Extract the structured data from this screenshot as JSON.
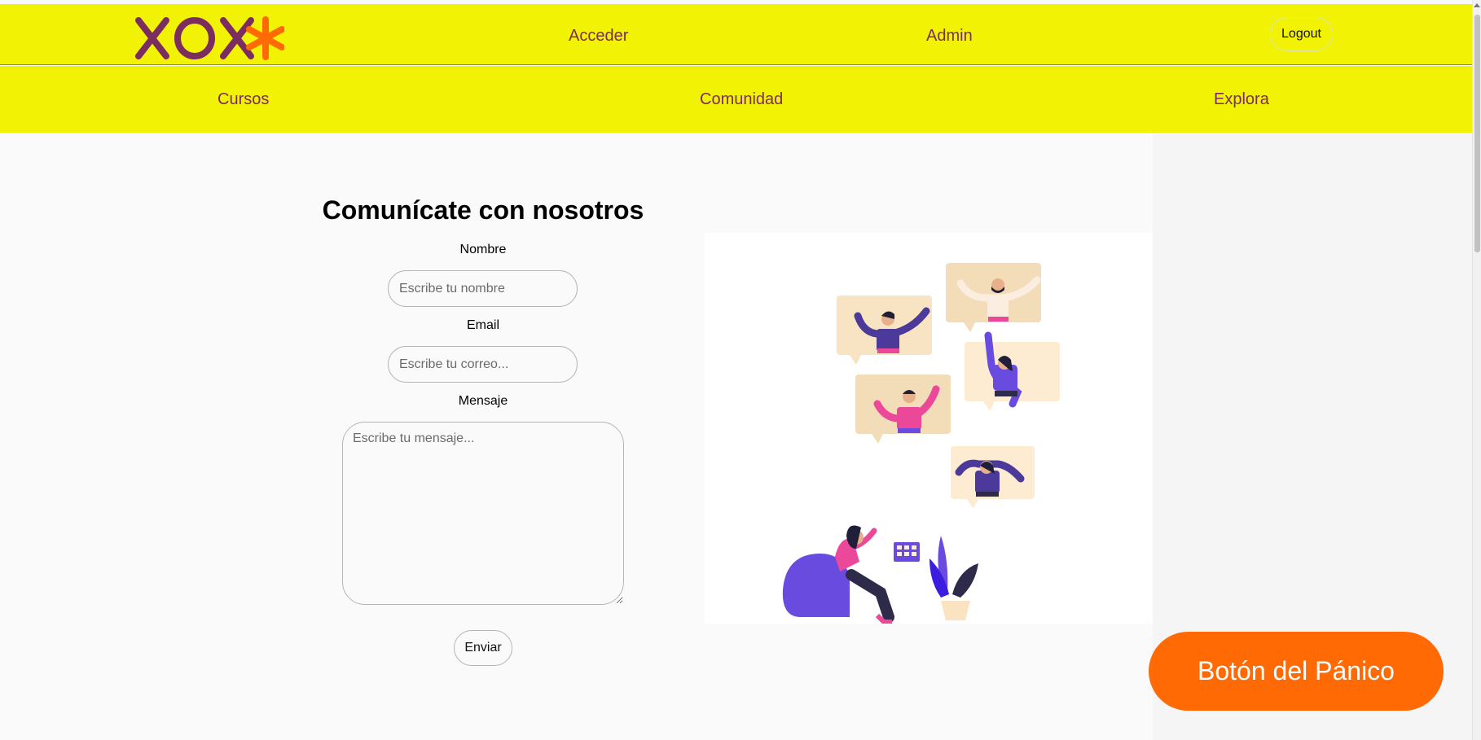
{
  "header": {
    "logo_text": "XOX*",
    "nav": {
      "acceder": "Acceder",
      "admin": "Admin"
    },
    "logout_label": "Logout"
  },
  "subnav": {
    "cursos": "Cursos",
    "comunidad": "Comunidad",
    "explora": "Explora"
  },
  "contact_form": {
    "title": "Comunícate con nosotros",
    "name_label": "Nombre",
    "name_placeholder": "Escribe tu nombre",
    "email_label": "Email",
    "email_placeholder": "Escribe tu correo...",
    "message_label": "Mensaje",
    "message_placeholder": "Escribe tu mensaje...",
    "submit_label": "Enviar"
  },
  "panic_button_label": "Botón del Pánico",
  "colors": {
    "nav_background": "#f2f205",
    "nav_text": "#7a2d5e",
    "logo_x": "#7a2d5e",
    "logo_star": "#ff6a05",
    "panic_button": "#ff6a05",
    "illustration_purple": "#6a4be0",
    "illustration_pink": "#ec4899",
    "illustration_beige": "#f3dcb8"
  }
}
